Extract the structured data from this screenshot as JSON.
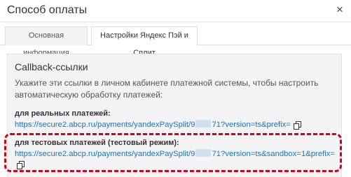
{
  "dialog": {
    "title": "Способ оплаты",
    "close_label": "×"
  },
  "tabs": [
    {
      "label": "Основная информация",
      "active": false
    },
    {
      "label": "Настройки Яндекс Пэй и Сплит",
      "active": true
    }
  ],
  "callback": {
    "title": "Callback-ссылки",
    "description": "Укажите эти ссылки в личном кабинете платежной системы, чтобы настроить автоматическую обработку платежей:",
    "real": {
      "label": "для реальных платежей:",
      "url_prefix": "https://secure2.abcp.ru/payments/yandexPaySplit/9",
      "url_suffix": "71?version=ts&prefix="
    },
    "test": {
      "label": "для тестовых платежей (тестовый режим):",
      "url_prefix": "https://secure2.abcp.ru/payments/yandexPaySplit/9",
      "url_suffix": "71?version=ts&sandbox=1&prefix="
    }
  },
  "colors": {
    "link": "#1a73c8",
    "highlight": "#d0021b",
    "panel_bg": "#f4f4f4"
  },
  "icons": {
    "copy": "copy-icon",
    "close": "close-icon"
  }
}
